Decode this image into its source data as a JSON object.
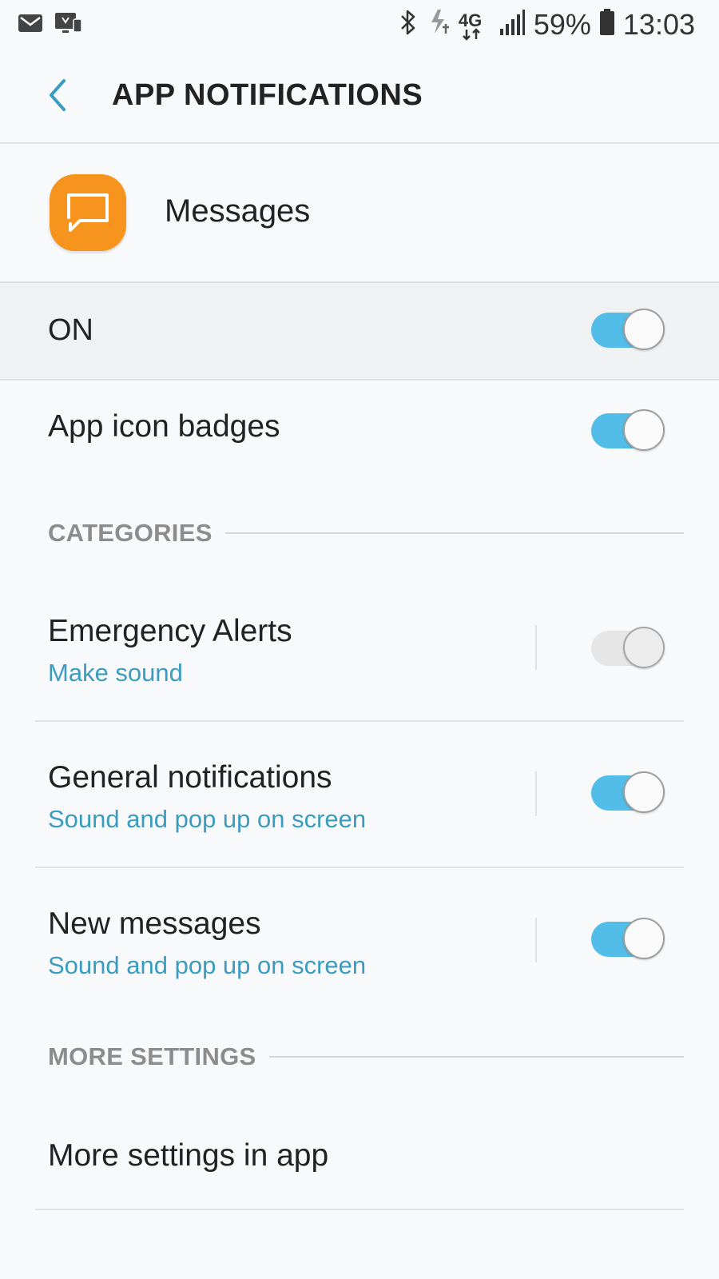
{
  "status_bar": {
    "battery": "59%",
    "time": "13:03",
    "network": "4G",
    "icons": [
      "email-icon",
      "screen-cast-icon",
      "bluetooth-icon",
      "data-saver-icon",
      "network-4g-icon",
      "signal-icon",
      "battery-icon"
    ]
  },
  "header": {
    "title": "APP NOTIFICATIONS",
    "back_icon": "chevron-left-icon"
  },
  "app": {
    "name": "Messages",
    "icon": "messages-app-icon",
    "icon_color": "#f7941d"
  },
  "master": {
    "label": "ON",
    "enabled": true
  },
  "badges": {
    "label": "App icon badges",
    "enabled": true
  },
  "categories": {
    "header": "CATEGORIES",
    "items": [
      {
        "title": "Emergency Alerts",
        "subtitle": "Make sound",
        "enabled": false
      },
      {
        "title": "General notifications",
        "subtitle": "Sound and pop up on screen",
        "enabled": true
      },
      {
        "title": "New messages",
        "subtitle": "Sound and pop up on screen",
        "enabled": true
      }
    ]
  },
  "more_settings": {
    "header": "MORE SETTINGS",
    "item_label": "More settings in app"
  },
  "colors": {
    "accent": "#52bde8",
    "subtitle": "#3b9cc0",
    "section_header": "#8c8c8c"
  }
}
